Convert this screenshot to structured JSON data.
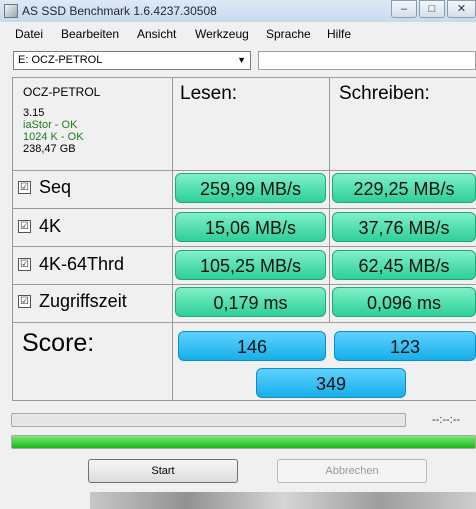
{
  "window": {
    "title": "AS SSD Benchmark 1.6.4237.30508"
  },
  "menu": [
    "Datei",
    "Bearbeiten",
    "Ansicht",
    "Werkzeug",
    "Sprache",
    "Hilfe"
  ],
  "drive_select": {
    "value": "E: OCZ-PETROL"
  },
  "drive_info": {
    "name": "OCZ-PETROL",
    "firmware": "3.15",
    "driver": "iaStor - OK",
    "alignment": "1024 K - OK",
    "size": "238,47 GB"
  },
  "columns": {
    "read": "Lesen:",
    "write": "Schreiben:"
  },
  "rows": [
    {
      "label": "Seq",
      "read": "259,99 MB/s",
      "write": "229,25 MB/s",
      "checked": true
    },
    {
      "label": "4K",
      "read": "15,06 MB/s",
      "write": "37,76 MB/s",
      "checked": true
    },
    {
      "label": "4K-64Thrd",
      "read": "105,25 MB/s",
      "write": "62,45 MB/s",
      "checked": true
    },
    {
      "label": "Zugriffszeit",
      "read": "0,179 ms",
      "write": "0,096 ms",
      "checked": true
    }
  ],
  "score": {
    "label": "Score:",
    "read": "146",
    "write": "123",
    "total": "349"
  },
  "progress": {
    "time": "--:--:--",
    "top_fraction": 0.0,
    "bottom_fraction": 1.0
  },
  "buttons": {
    "start": "Start",
    "cancel": "Abbrechen"
  },
  "checkbox_glyph": "☑",
  "colors": {
    "result_green": "#2ecf98",
    "score_blue": "#16aee8",
    "progress_green": "#18b818"
  }
}
